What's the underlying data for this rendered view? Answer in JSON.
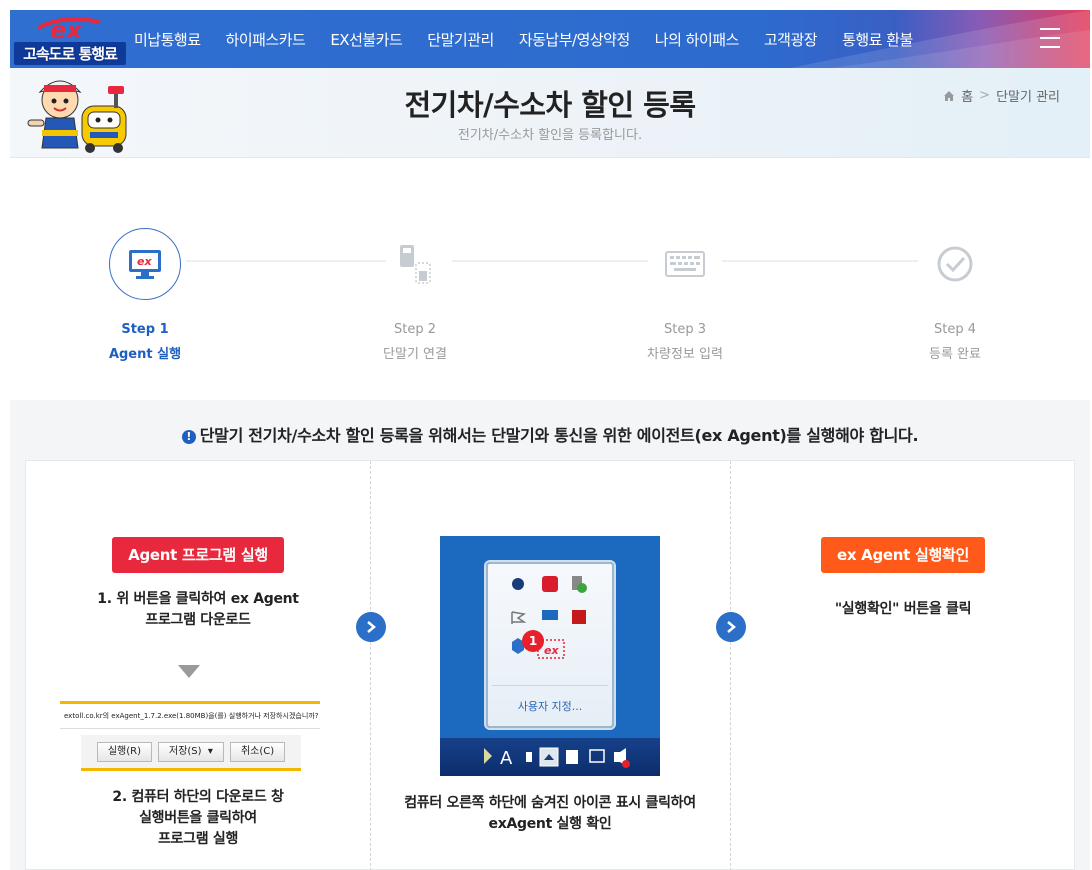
{
  "logo": {
    "mark": "ex",
    "text": "고속도로 통행료"
  },
  "nav": {
    "items": [
      "미납통행료",
      "하이패스카드",
      "EX선불카드",
      "단말기관리",
      "자동납부/영상약정",
      "나의 하이패스",
      "고객광장",
      "통행료 환불"
    ],
    "menu_icon": "hamburger-icon"
  },
  "header": {
    "title": "전기차/수소차 할인 등록",
    "subtitle": "전기차/수소차 할인을 등록합니다.",
    "breadcrumb": [
      "홈",
      "단말기 관리"
    ]
  },
  "steps": [
    {
      "num": "Step 1",
      "label": "Agent 실행",
      "active": true,
      "icon": "monitor-ex-icon"
    },
    {
      "num": "Step 2",
      "label": "단말기 연결",
      "active": false,
      "icon": "device-connect-icon"
    },
    {
      "num": "Step 3",
      "label": "차량정보 입력",
      "active": false,
      "icon": "keyboard-icon"
    },
    {
      "num": "Step 4",
      "label": "등록 완료",
      "active": false,
      "icon": "check-circle-icon"
    }
  ],
  "notice": "단말기 전기차/수소차 할인 등록을 위해서는 단말기와 통신을 위한 에이전트(ex Agent)를 실행해야 합니다.",
  "col1": {
    "button": "Agent 프로그램 실행",
    "desc1_line1": "1. 위 버튼을 클릭하여 ex Agent",
    "desc1_line2": "프로그램 다운로드",
    "download_text": "extoll.co.kr의 exAgent_1.7.2.exe(1.80MB)을(를) 실행하거나 저장하시겠습니까?",
    "dl_run": "실행(R)",
    "dl_save": "저장(S)",
    "dl_cancel": "취소(C)",
    "desc2_line1": "2. 컴퓨터 하단의 다운로드 창",
    "desc2_line2": "실행버튼을 클릭하여",
    "desc2_line3": "프로그램 실행"
  },
  "col2": {
    "tray_custom": "사용자 지정...",
    "badge": "1",
    "tray_ex": "ex",
    "desc_line1": "컴퓨터 오른쪽 하단에 숨겨진 아이콘 표시 클릭하여",
    "desc_line2": "exAgent 실행 확인"
  },
  "col3": {
    "button": "ex Agent 실행확인",
    "desc": "\"실행확인\" 버튼을 클릭"
  },
  "colors": {
    "primary": "#1f5fbf",
    "red": "#e8283c",
    "orange": "#ff5a1a"
  }
}
